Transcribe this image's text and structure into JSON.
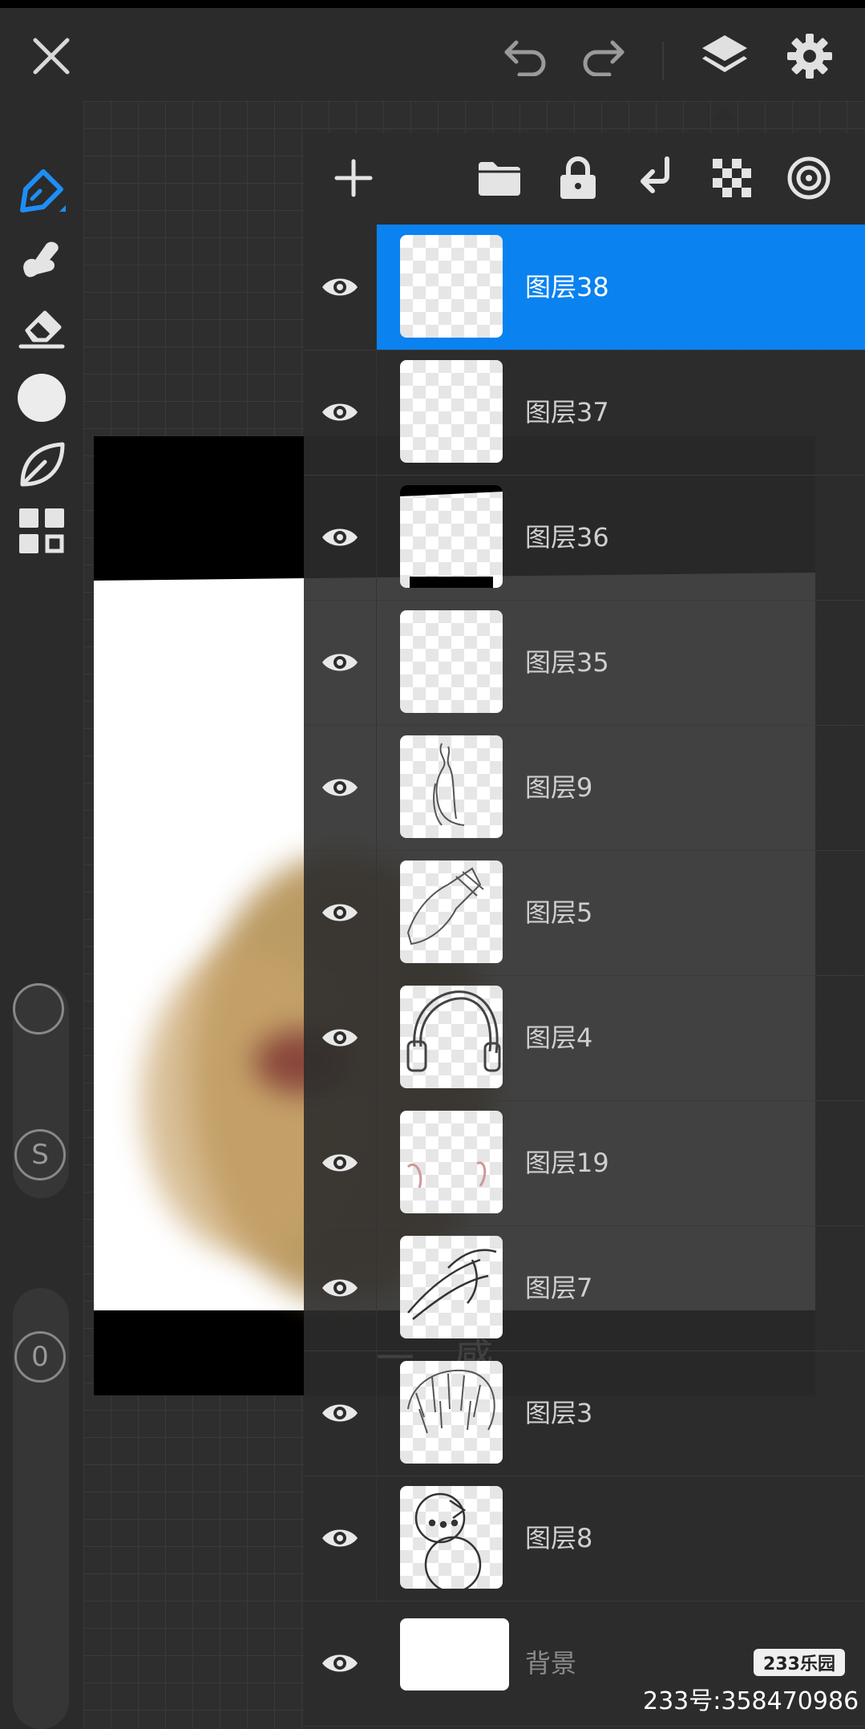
{
  "layers": [
    {
      "name": "图层38",
      "active": true
    },
    {
      "name": "图层37",
      "active": false
    },
    {
      "name": "图层36",
      "active": false
    },
    {
      "name": "图层35",
      "active": false
    },
    {
      "name": "图层9",
      "active": false
    },
    {
      "name": "图层5",
      "active": false
    },
    {
      "name": "图层4",
      "active": false
    },
    {
      "name": "图层19",
      "active": false
    },
    {
      "name": "图层7",
      "active": false
    },
    {
      "name": "图层3",
      "active": false
    },
    {
      "name": "图层8",
      "active": false
    },
    {
      "name": "背景",
      "active": false
    }
  ],
  "sidebar": {
    "size_slider_label": "S",
    "opacity_slider_label": "0"
  },
  "canvas": {
    "caption": "一感"
  },
  "watermark": {
    "logo": "233乐园",
    "id_text": "233号:358470986"
  },
  "colors": {
    "accent": "#0a82f0",
    "background": "#242424",
    "panel": "#2c2c2c"
  },
  "icons": {
    "topbar": [
      "close-icon",
      "undo-icon",
      "redo-icon",
      "layers-icon",
      "gear-icon"
    ],
    "tools": [
      "pen-icon",
      "smudge-icon",
      "eraser-icon",
      "color-icon",
      "leaf-icon",
      "grid-icon"
    ],
    "layer_panel": [
      "add-icon",
      "folder-icon",
      "lock-icon",
      "merge-down-icon",
      "checker-icon",
      "blend-icon"
    ]
  }
}
